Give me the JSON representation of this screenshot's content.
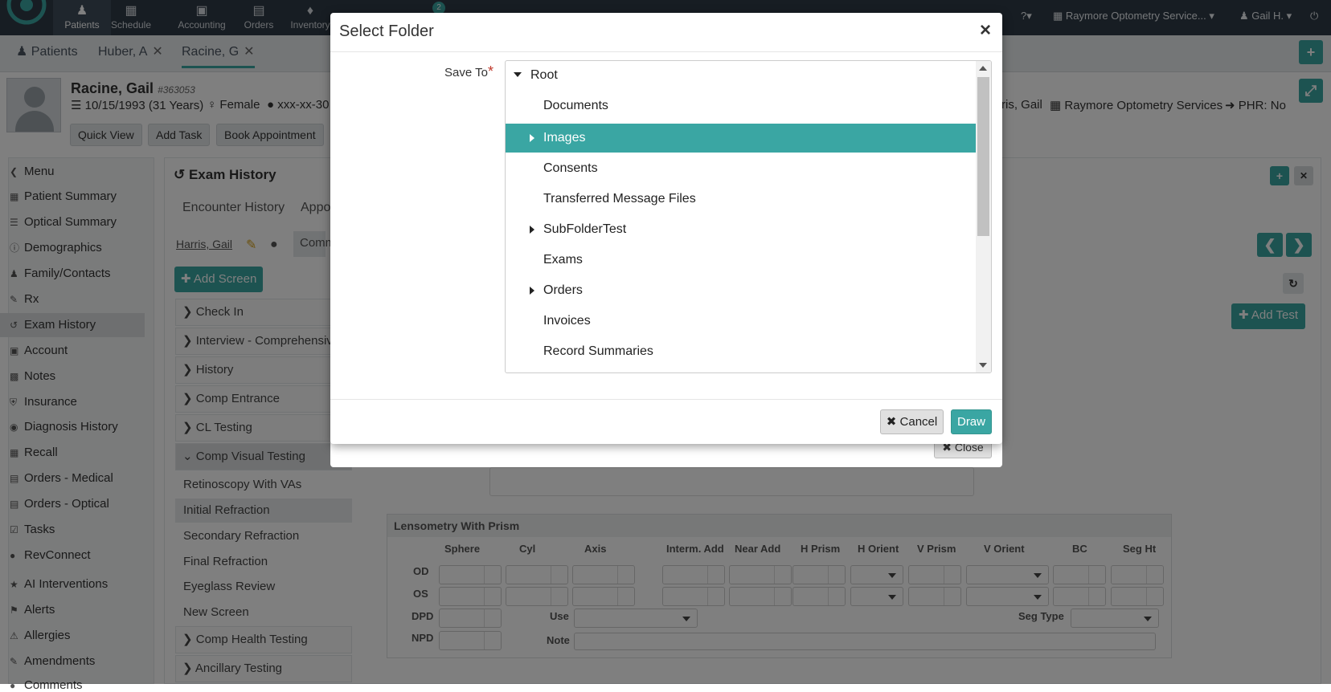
{
  "topnav": {
    "items": [
      {
        "label": "Patients",
        "icon": "users-icon"
      },
      {
        "label": "Schedule",
        "icon": "calendar-icon"
      },
      {
        "label": "Accounting",
        "icon": "money-icon"
      },
      {
        "label": "Orders",
        "icon": "cart-icon"
      },
      {
        "label": "Inventory",
        "icon": "cubes-icon"
      }
    ],
    "badge": "2",
    "office": "Raymore Optometry Service...",
    "user": "Gail H."
  },
  "patient_tabs": {
    "patients": "Patients",
    "tab1": "Huber, A",
    "tab2": "Racine, G"
  },
  "patient": {
    "name": "Racine, Gail",
    "id": "#363053",
    "dob": "10/15/1993 (31 Years)",
    "gender": "Female",
    "ssn": "xxx-xx-30",
    "provider": "ris, Gail",
    "location": "Raymore Optometry Services",
    "phr": "PHR: No"
  },
  "header_buttons": {
    "quick_view": "Quick View",
    "add_task": "Add Task",
    "book": "Book Appointment"
  },
  "sidebar": {
    "items": [
      "Menu",
      "Patient Summary",
      "Optical Summary",
      "Demographics",
      "Family/Contacts",
      "Rx",
      "Exam History",
      "Account",
      "Notes",
      "Insurance",
      "Diagnosis History",
      "Recall",
      "Orders - Medical",
      "Orders - Optical",
      "Tasks",
      "RevConnect",
      "AI Interventions",
      "Alerts",
      "Allergies",
      "Amendments",
      "Comments"
    ]
  },
  "exam": {
    "title": "Exam History",
    "tab_encounter": "Encounter History",
    "tab_appo": "Appo",
    "provider": "Harris, Gail",
    "comm": "Comm",
    "add_screen": "Add Screen",
    "add_test": "Add Test",
    "close": "Close",
    "sections": [
      "Check In",
      "Interview - Comprehensive",
      "History",
      "Comp Entrance",
      "CL Testing",
      "Comp Visual Testing"
    ],
    "sub_items": [
      "Retinoscopy With VAs",
      "Initial Refraction",
      "Secondary Refraction",
      "Final Refraction",
      "Eyeglass Review",
      "New Screen"
    ],
    "sections_after": [
      "Comp Health Testing",
      "Ancillary Testing"
    ]
  },
  "lensometry": {
    "title": "Lensometry With Prism",
    "columns": [
      "Sphere",
      "Cyl",
      "Axis",
      "Interm. Add",
      "Near Add",
      "H Prism",
      "H Orient",
      "V Prism",
      "V Orient",
      "BC",
      "Seg Ht"
    ],
    "rows": [
      "OD",
      "OS",
      "DPD",
      "NPD"
    ],
    "use": "Use",
    "note": "Note",
    "seg_type": "Seg Type"
  },
  "modal": {
    "title": "Select Folder",
    "close": "×",
    "save_to": "Save To",
    "required": "*",
    "tree": [
      {
        "label": "Root",
        "arrow": "down",
        "level": 0
      },
      {
        "label": "Documents",
        "arrow": "none",
        "level": 1
      },
      {
        "label": "Images",
        "arrow": "right",
        "level": 1,
        "selected": true
      },
      {
        "label": "Consents",
        "arrow": "none",
        "level": 1
      },
      {
        "label": "Transferred Message Files",
        "arrow": "none",
        "level": 1
      },
      {
        "label": "SubFolderTest",
        "arrow": "right",
        "level": 1
      },
      {
        "label": "Exams",
        "arrow": "none",
        "level": 1
      },
      {
        "label": "Orders",
        "arrow": "right",
        "level": 1
      },
      {
        "label": "Invoices",
        "arrow": "none",
        "level": 1
      },
      {
        "label": "Record Summaries",
        "arrow": "none",
        "level": 1
      }
    ],
    "cancel": "Cancel",
    "draw": "Draw"
  },
  "colors": {
    "accent": "#3aa6a3",
    "navbar": "#2f3b47"
  }
}
